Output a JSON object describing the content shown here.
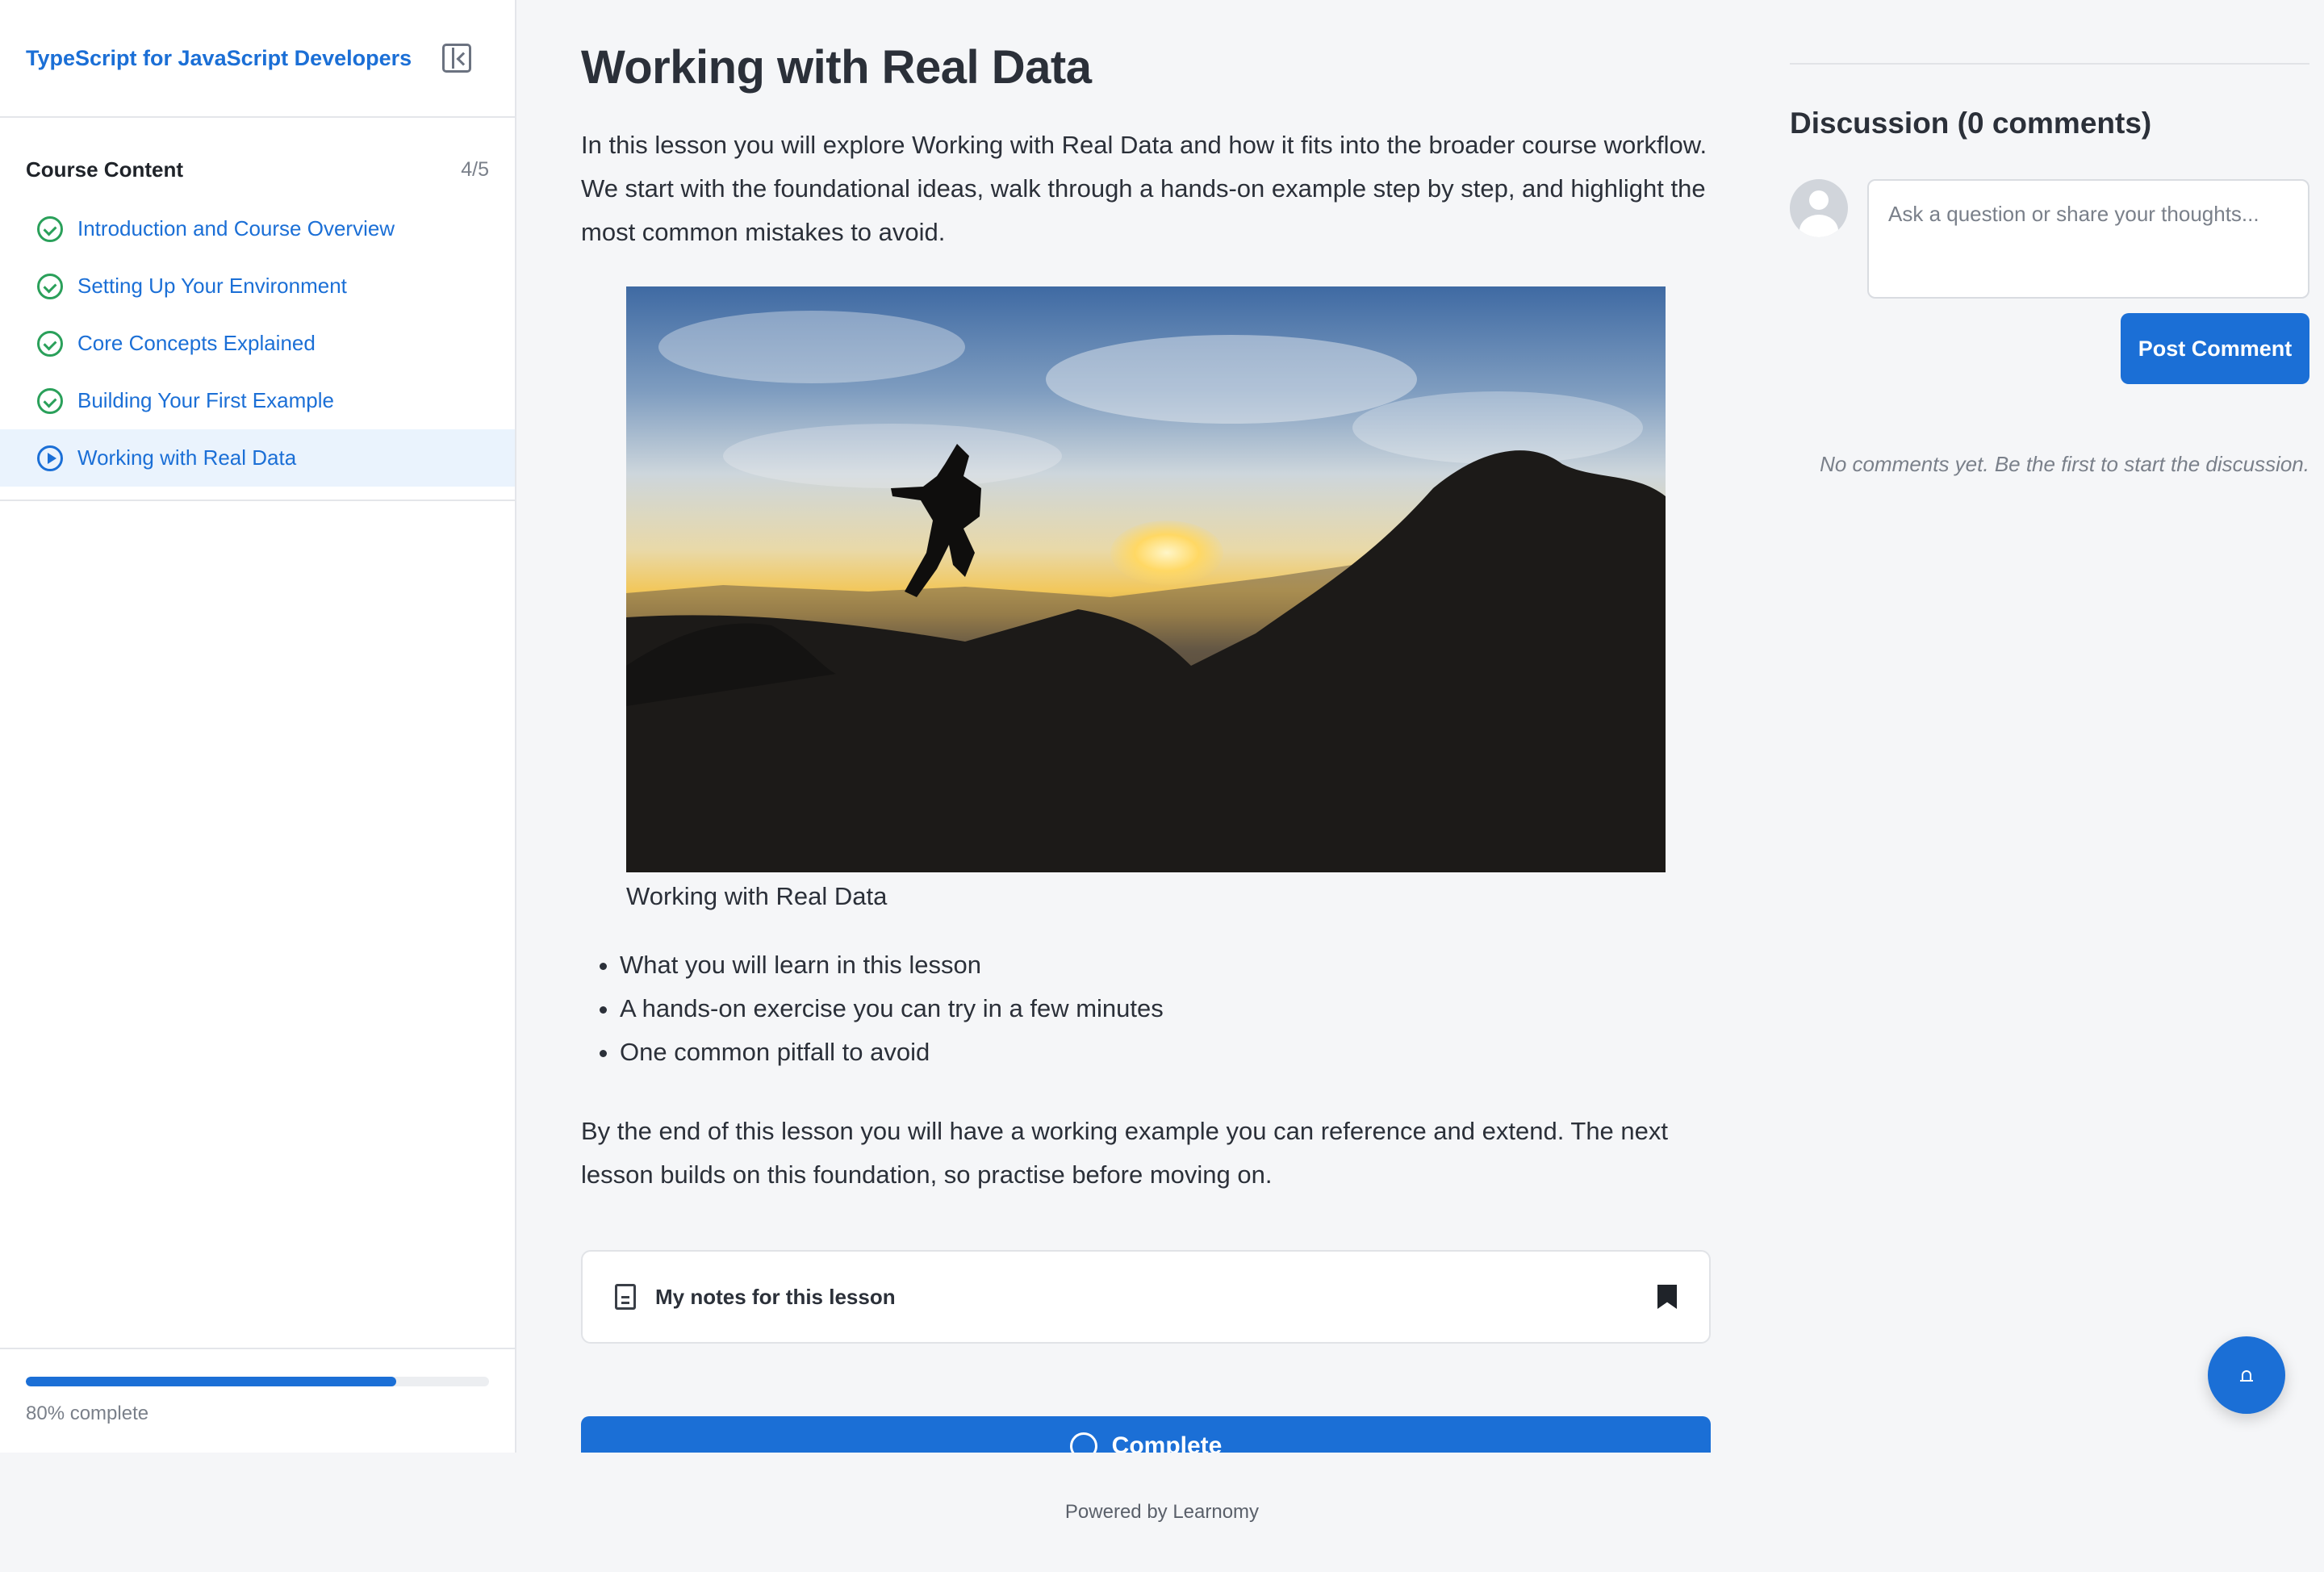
{
  "sidebar": {
    "course_title": "TypeScript for JavaScript Developers",
    "section_label": "Course Content",
    "section_count": "4/5",
    "lessons": [
      {
        "label": "Introduction and Course Overview",
        "status": "completed"
      },
      {
        "label": "Setting Up Your Environment",
        "status": "completed"
      },
      {
        "label": "Core Concepts Explained",
        "status": "completed"
      },
      {
        "label": "Building Your First Example",
        "status": "completed"
      },
      {
        "label": "Working with Real Data",
        "status": "current"
      }
    ],
    "progress_percent": 80,
    "progress_text": "80% complete"
  },
  "lesson": {
    "title": "Working with Real Data",
    "intro": "In this lesson you will explore Working with Real Data and how it fits into the broader course workflow. We start with the foundational ideas, walk through a hands-on example step by step, and highlight the most common mistakes to avoid.",
    "image_caption": "Working with Real Data",
    "bullets": [
      "What you will learn in this lesson",
      "A hands-on exercise you can try in a few minutes",
      "One common pitfall to avoid"
    ],
    "closing": "By the end of this lesson you will have a working example you can reference and extend. The next lesson builds on this foundation, so practise before moving on.",
    "notes_label": "My notes for this lesson",
    "complete_label": "Complete"
  },
  "discussion": {
    "title": "Discussion (0 comments)",
    "placeholder": "Ask a question or share your thoughts...",
    "post_label": "Post Comment",
    "empty_text": "No comments yet. Be the first to start the discussion."
  },
  "footer": {
    "text": "Powered by Learnomy"
  },
  "colors": {
    "accent": "#1b6fd6",
    "completed": "#2aa05a",
    "active_bg": "#eaf3fd"
  },
  "icons": {
    "collapse": "sidebar-collapse-icon",
    "completed": "check-circle-icon",
    "current": "play-circle-icon",
    "notes": "document-icon",
    "bookmark": "bookmark-icon",
    "complete": "check-circle-icon",
    "fab": "bell-icon"
  }
}
